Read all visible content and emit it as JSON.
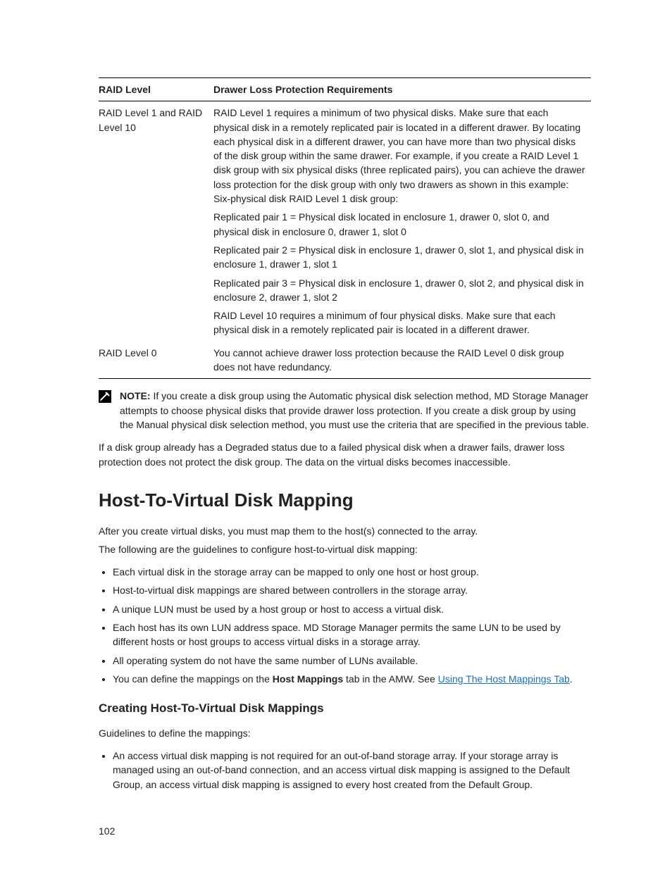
{
  "table": {
    "headers": [
      "RAID Level",
      "Drawer Loss Protection Requirements"
    ],
    "rows": [
      {
        "level": "RAID Level 1 and RAID Level 10",
        "paras": [
          "RAID Level 1 requires a minimum of two physical disks. Make sure that each physical disk in a remotely replicated pair is located in a different drawer. By locating each physical disk in a different drawer, you can have more than two physical disks of the disk group within the same drawer. For example, if you create a RAID Level 1 disk group with six physical disks (three replicated pairs), you can achieve the drawer loss protection for the disk group with only two drawers as shown in this example: Six-physical disk RAID Level 1 disk group:",
          "Replicated pair 1 = Physical disk located in enclosure 1, drawer 0, slot 0, and physical disk in enclosure 0, drawer 1, slot 0",
          "Replicated pair 2 = Physical disk in enclosure 1, drawer 0, slot 1, and physical disk in enclosure 1, drawer 1, slot 1",
          "Replicated pair 3 = Physical disk in enclosure 1, drawer 0, slot 2, and physical disk in enclosure 2, drawer 1, slot 2",
          "RAID Level 10 requires a minimum of four physical disks. Make sure that each physical disk in a remotely replicated pair is located in a different drawer."
        ]
      },
      {
        "level": "RAID Level 0",
        "paras": [
          "You cannot achieve drawer loss protection because the RAID Level 0 disk group does not have redundancy."
        ]
      }
    ]
  },
  "note": {
    "label": "NOTE:",
    "text": " If you create a disk group using the Automatic physical disk selection method, MD Storage Manager attempts to choose physical disks that provide drawer loss protection. If you create a disk group by using the Manual physical disk selection method, you must use the criteria that are specified in the previous table."
  },
  "after_note_para": "If a disk group already has a Degraded status due to a failed physical disk when a drawer fails, drawer loss protection does not protect the disk group. The data on the virtual disks becomes inaccessible.",
  "section_heading": "Host-To-Virtual Disk Mapping",
  "section_intro_1": "After you create virtual disks, you must map them to the host(s) connected to the array.",
  "section_intro_2": "The following are the guidelines to configure host-to-virtual disk mapping:",
  "bullets": [
    "Each virtual disk in the storage array can be mapped to only one host or host group.",
    "Host-to-virtual disk mappings are shared between controllers in the storage array.",
    "A unique LUN must be used by a host group or host to access a virtual disk.",
    "Each host has its own LUN address space. MD Storage Manager permits the same LUN to be used by different hosts or host groups to access virtual disks in a storage array.",
    "All operating system do not have the same number of LUNs available."
  ],
  "last_bullet": {
    "pre": "You can define the mappings on the ",
    "bold": "Host Mappings",
    "mid": " tab in the AMW. See ",
    "link": "Using The Host Mappings Tab",
    "post": "."
  },
  "subsection_heading": "Creating Host-To-Virtual Disk Mappings",
  "subsection_intro": "Guidelines to define the mappings:",
  "sub_bullets": [
    "An access virtual disk mapping is not required for an out-of-band storage array. If your storage array is managed using an out-of-band connection, and an access virtual disk mapping is assigned to the Default Group, an access virtual disk mapping is assigned to every host created from the Default Group."
  ],
  "page_number": "102"
}
